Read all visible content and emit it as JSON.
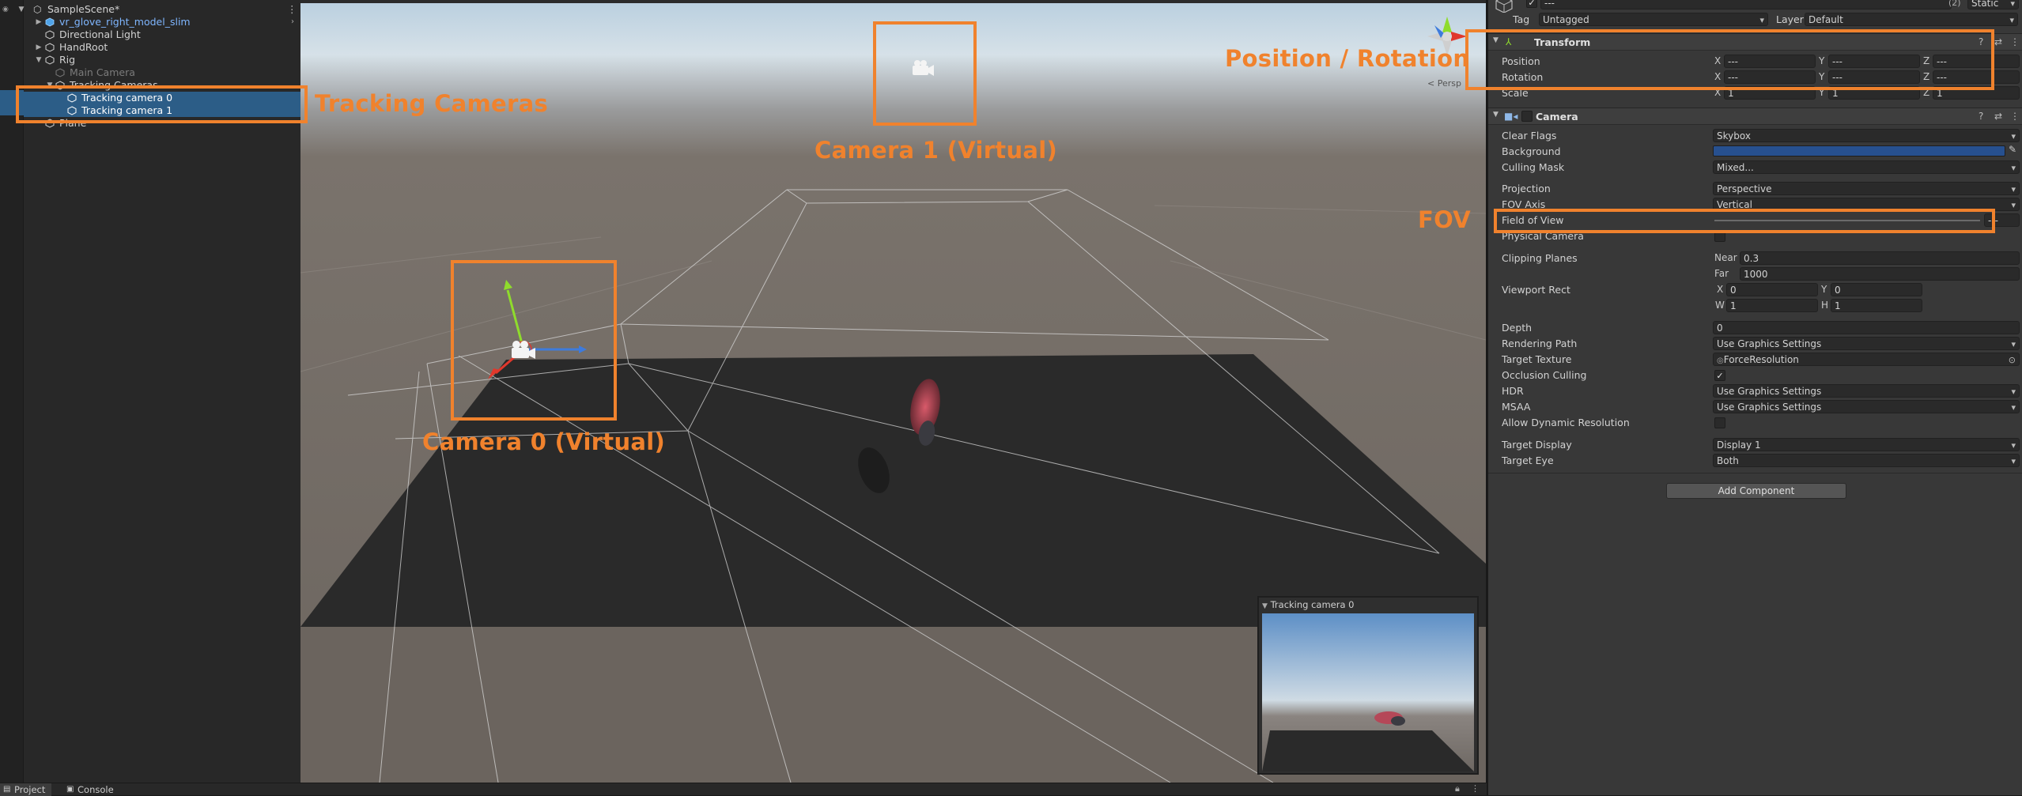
{
  "hierarchy": {
    "scene_name": "SampleScene*",
    "items": [
      {
        "label": "vr_glove_right_model_slim"
      },
      {
        "label": "Directional Light"
      },
      {
        "label": "HandRoot"
      },
      {
        "label": "Rig"
      },
      {
        "label": "Main Camera"
      },
      {
        "label": "Tracking Cameras"
      },
      {
        "label": "Tracking camera 0"
      },
      {
        "label": "Tracking camera 1"
      },
      {
        "label": "Plane"
      }
    ]
  },
  "scene": {
    "persp_label": "< Persp",
    "preview_title": "Tracking camera 0"
  },
  "annotations": {
    "tracking_cameras": "Tracking Cameras",
    "camera1": "Camera 1 (Virtual)",
    "camera0": "Camera 0 (Virtual)",
    "position_rotation": "Position / Rotation",
    "fov": "FOV",
    "color": "#f0822d"
  },
  "inspector": {
    "name_value": "---",
    "static_count": "(2)",
    "static_label": "Static",
    "tag_label": "Tag",
    "tag_value": "Untagged",
    "layer_label": "Layer",
    "layer_value": "Default",
    "transform": {
      "title": "Transform",
      "position_label": "Position",
      "rotation_label": "Rotation",
      "scale_label": "Scale",
      "position": {
        "x": "---",
        "y": "---",
        "z": "---"
      },
      "rotation": {
        "x": "---",
        "y": "---",
        "z": "---"
      },
      "scale": {
        "x": "1",
        "y": "1",
        "z": "1"
      },
      "x": "X",
      "y": "Y",
      "z": "Z"
    },
    "camera": {
      "title": "Camera",
      "clear_flags_label": "Clear Flags",
      "clear_flags_value": "Skybox",
      "background_label": "Background",
      "background_color": "#27508f",
      "culling_mask_label": "Culling Mask",
      "culling_mask_value": "Mixed...",
      "projection_label": "Projection",
      "projection_value": "Perspective",
      "fov_axis_label": "FOV Axis",
      "fov_axis_value": "Vertical",
      "fov_label": "Field of View",
      "fov_value": "---",
      "physical_camera_label": "Physical Camera",
      "clipping_planes_label": "Clipping Planes",
      "near_label": "Near",
      "near_value": "0.3",
      "far_label": "Far",
      "far_value": "1000",
      "viewport_rect_label": "Viewport Rect",
      "vp_x_label": "X",
      "vp_x_value": "0",
      "vp_y_label": "Y",
      "vp_y_value": "0",
      "vp_w_label": "W",
      "vp_w_value": "1",
      "vp_h_label": "H",
      "vp_h_value": "1",
      "depth_label": "Depth",
      "depth_value": "0",
      "rendering_path_label": "Rendering Path",
      "rendering_path_value": "Use Graphics Settings",
      "target_texture_label": "Target Texture",
      "target_texture_value": "ForceResolution",
      "occlusion_culling_label": "Occlusion Culling",
      "hdr_label": "HDR",
      "hdr_value": "Use Graphics Settings",
      "msaa_label": "MSAA",
      "msaa_value": "Use Graphics Settings",
      "dynamic_res_label": "Allow Dynamic Resolution",
      "target_display_label": "Target Display",
      "target_display_value": "Display 1",
      "target_eye_label": "Target Eye",
      "target_eye_value": "Both"
    },
    "add_component_label": "Add Component"
  },
  "bottom_tabs": {
    "project": "Project",
    "console": "Console"
  }
}
